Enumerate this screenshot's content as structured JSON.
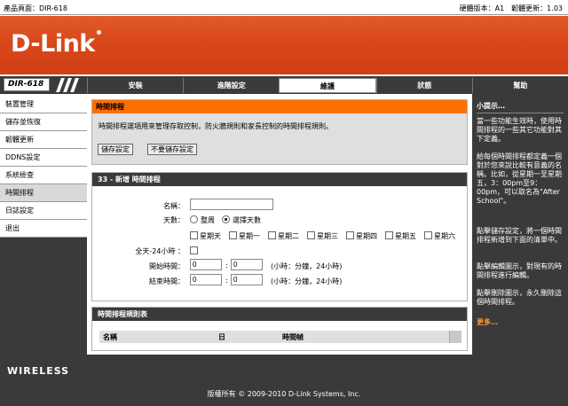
{
  "topbar": {
    "product": "產品頁面：DIR-618",
    "version": "硬體版本：A1　韌體更新：1.03"
  },
  "brand": {
    "logo": "D-Link",
    "model": "DIR-618",
    "wireless": "WIRELESS"
  },
  "tabs": [
    {
      "label": "安裝"
    },
    {
      "label": "進階設定"
    },
    {
      "label": "維護"
    },
    {
      "label": "狀態"
    },
    {
      "label": "幫助"
    }
  ],
  "sidebar": {
    "items": [
      {
        "label": "裝置管理"
      },
      {
        "label": "儲存並恢復"
      },
      {
        "label": "韌體更新"
      },
      {
        "label": "DDNS設定"
      },
      {
        "label": "系統檢查"
      },
      {
        "label": "時間排程"
      },
      {
        "label": "日誌設定"
      },
      {
        "label": "退出"
      }
    ]
  },
  "schedule_intro": {
    "title": "時間排程",
    "description": "時間排程選項用來管理存取控制，防火牆規則和家長控制的時間排程規則。",
    "save_label": "儲存設定",
    "nosave_label": "不要儲存設定"
  },
  "add_schedule": {
    "title": "33 - 新增 時間排程",
    "name_label": "名稱：",
    "name_value": "",
    "days_label": "天數：",
    "all_week": "整周",
    "select_days": "選擇天數",
    "days": [
      "星期天",
      "星期一",
      "星期二",
      "星期三",
      "星期四",
      "星期五",
      "星期六"
    ],
    "all_day_label": "全天-24小時 ：",
    "start_label": "開始時間：",
    "end_label": "結束時間：",
    "start_hour": "0",
    "start_min": "0",
    "end_hour": "0",
    "end_min": "0",
    "time_hint": "(小時：分鐘，24小時)"
  },
  "rules_list": {
    "title": "時間排程規則表",
    "columns": [
      "名稱",
      "日",
      "時間幀"
    ]
  },
  "help": {
    "title": "小提示…",
    "p1": "當一些功能生效時，使用時間排程的一些其它功能對其下定義。",
    "p2": "給每個時間排程都定義一個對於您來說比較有意義的名稱。比如，從星期一至星期五，3：00pm至9：00pm，可以取名為\"After School\"。",
    "p3": "點擊儲存設定，將一個時間排程新增到下面的清單中。",
    "p4": "點擊編輯圖示，對現有的時間排程進行編輯。",
    "p5": "點擊刪除圖示，永久刪除這個時間排程。",
    "more": "更多…"
  },
  "footer": {
    "copyright": "版權所有 © 2009-2010 D-Link Systems, Inc."
  }
}
